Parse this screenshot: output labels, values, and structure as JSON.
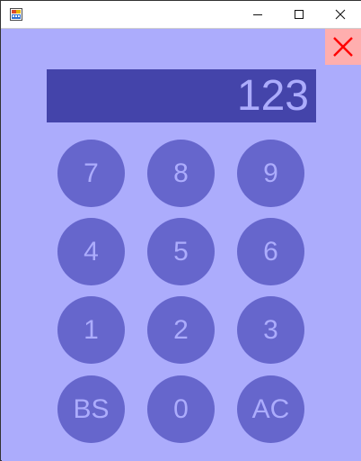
{
  "window": {
    "icon": "app-icon",
    "controls": {
      "minimize": "minimize-icon",
      "maximize": "maximize-icon",
      "close": "close-icon"
    }
  },
  "app": {
    "close_icon": "close-x-icon",
    "display_value": "123",
    "keys": [
      "7",
      "8",
      "9",
      "4",
      "5",
      "6",
      "1",
      "2",
      "3",
      "BS",
      "0",
      "AC"
    ]
  },
  "colors": {
    "background": "#acacfc",
    "display_bg": "#4444aa",
    "key_bg": "#6666cc",
    "key_text": "#acacfc",
    "close_bg": "#ffaeae",
    "close_x": "#ff0000"
  }
}
